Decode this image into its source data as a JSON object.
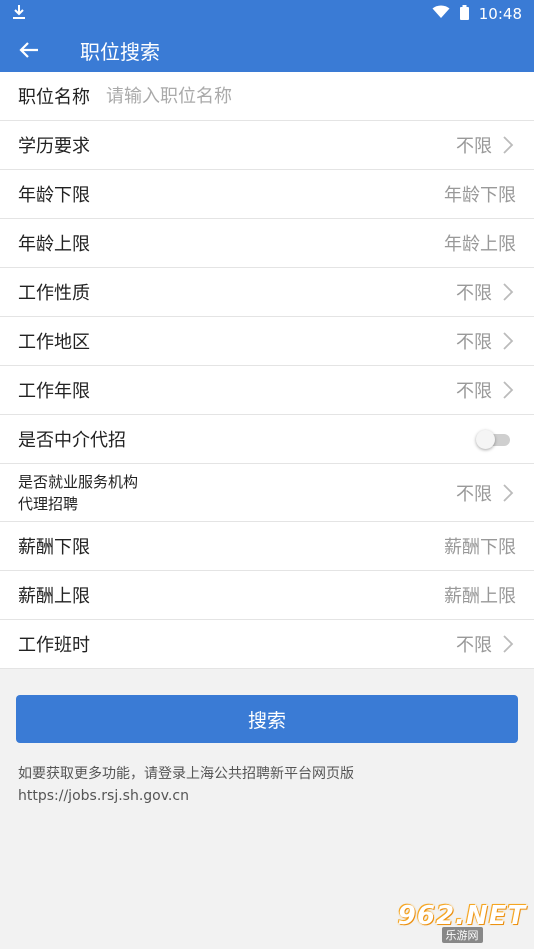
{
  "status": {
    "time": "10:48"
  },
  "header": {
    "title": "职位搜索"
  },
  "form": {
    "job_name": {
      "label": "职位名称",
      "placeholder": "请输入职位名称"
    },
    "education": {
      "label": "学历要求",
      "value": "不限"
    },
    "age_min": {
      "label": "年龄下限",
      "value": "年龄下限"
    },
    "age_max": {
      "label": "年龄上限",
      "value": "年龄上限"
    },
    "job_nature": {
      "label": "工作性质",
      "value": "不限"
    },
    "work_area": {
      "label": "工作地区",
      "value": "不限"
    },
    "work_years": {
      "label": "工作年限",
      "value": "不限"
    },
    "agency": {
      "label": "是否中介代招",
      "enabled": false
    },
    "employment_agency": {
      "label_line1": "是否就业服务机构",
      "label_line2": "代理招聘",
      "value": "不限"
    },
    "salary_min": {
      "label": "薪酬下限",
      "value": "薪酬下限"
    },
    "salary_max": {
      "label": "薪酬上限",
      "value": "薪酬上限"
    },
    "work_shift": {
      "label": "工作班时",
      "value": "不限"
    }
  },
  "actions": {
    "search_label": "搜索"
  },
  "note": {
    "line1": "如要获取更多功能，请登录上海公共招聘新平台网页版",
    "line2": "https://jobs.rsj.sh.gov.cn"
  },
  "watermark": {
    "logo": "962.NET",
    "sub": "乐游网"
  },
  "colors": {
    "primary": "#3a7bd5",
    "background": "#f2f2f2"
  }
}
